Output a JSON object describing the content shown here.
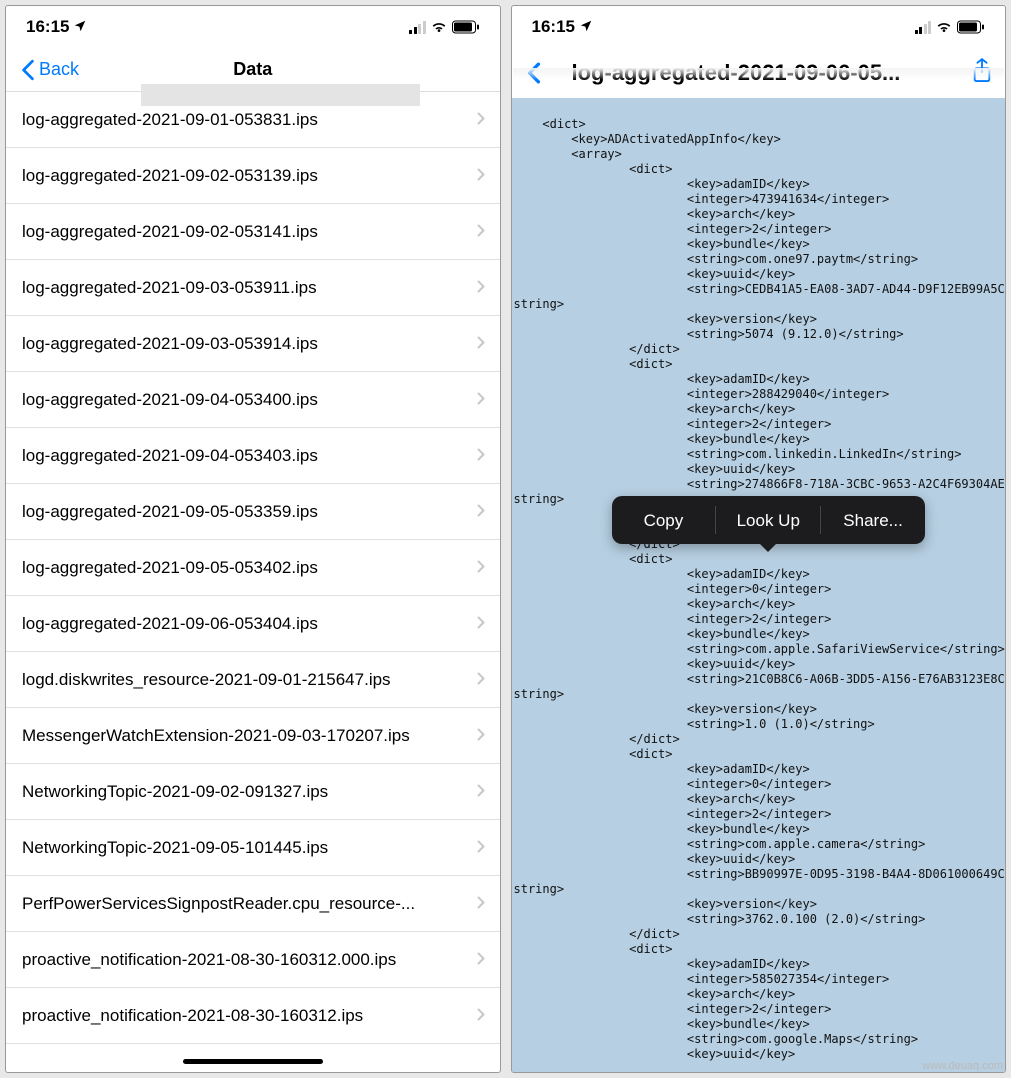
{
  "status": {
    "time": "16:15",
    "location_icon": "location-arrow"
  },
  "left": {
    "back_label": "Back",
    "title": "Data",
    "files": [
      "log-aggregated-2021-09-01-053831.ips",
      "log-aggregated-2021-09-02-053139.ips",
      "log-aggregated-2021-09-02-053141.ips",
      "log-aggregated-2021-09-03-053911.ips",
      "log-aggregated-2021-09-03-053914.ips",
      "log-aggregated-2021-09-04-053400.ips",
      "log-aggregated-2021-09-04-053403.ips",
      "log-aggregated-2021-09-05-053359.ips",
      "log-aggregated-2021-09-05-053402.ips",
      "log-aggregated-2021-09-06-053404.ips",
      "logd.diskwrites_resource-2021-09-01-215647.ips",
      "MessengerWatchExtension-2021-09-03-170207.ips",
      "NetworkingTopic-2021-09-02-091327.ips",
      "NetworkingTopic-2021-09-05-101445.ips",
      "PerfPowerServicesSignpostReader.cpu_resource-...",
      "proactive_notification-2021-08-30-160312.000.ips",
      "proactive_notification-2021-08-30-160312.ips"
    ]
  },
  "right": {
    "title": "log-aggregated-2021-09-06-05...",
    "menu": {
      "copy": "Copy",
      "lookup": "Look Up",
      "share": "Share..."
    },
    "xml": "<dict>\n        <key>ADActivatedAppInfo</key>\n        <array>\n                <dict>\n                        <key>adamID</key>\n                        <integer>473941634</integer>\n                        <key>arch</key>\n                        <integer>2</integer>\n                        <key>bundle</key>\n                        <string>com.one97.paytm</string>\n                        <key>uuid</key>\n                        <string>CEDB41A5-EA08-3AD7-AD44-D9F12EB99A5C</\nstring>\n                        <key>version</key>\n                        <string>5074 (9.12.0)</string>\n                </dict>\n                <dict>\n                        <key>adamID</key>\n                        <integer>288429040</integer>\n                        <key>arch</key>\n                        <integer>2</integer>\n                        <key>bundle</key>\n                        <string>com.linkedin.LinkedIn</string>\n                        <key>uuid</key>\n                        <string>274866F8-718A-3CBC-9653-A2C4F69304AE</\nstring>\n                        <key>version</key>\n                        \n                </dict>\n                <dict>\n                        <key>adamID</key>\n                        <integer>0</integer>\n                        <key>arch</key>\n                        <integer>2</integer>\n                        <key>bundle</key>\n                        <string>com.apple.SafariViewService</string>\n                        <key>uuid</key>\n                        <string>21C0B8C6-A06B-3DD5-A156-E76AB3123E8C</\nstring>\n                        <key>version</key>\n                        <string>1.0 (1.0)</string>\n                </dict>\n                <dict>\n                        <key>adamID</key>\n                        <integer>0</integer>\n                        <key>arch</key>\n                        <integer>2</integer>\n                        <key>bundle</key>\n                        <string>com.apple.camera</string>\n                        <key>uuid</key>\n                        <string>BB90997E-0D95-3198-B4A4-8D061000649C</\nstring>\n                        <key>version</key>\n                        <string>3762.0.100 (2.0)</string>\n                </dict>\n                <dict>\n                        <key>adamID</key>\n                        <integer>585027354</integer>\n                        <key>arch</key>\n                        <integer>2</integer>\n                        <key>bundle</key>\n                        <string>com.google.Maps</string>\n                        <key>uuid</key>"
  },
  "watermark": "www.deuaq.com"
}
